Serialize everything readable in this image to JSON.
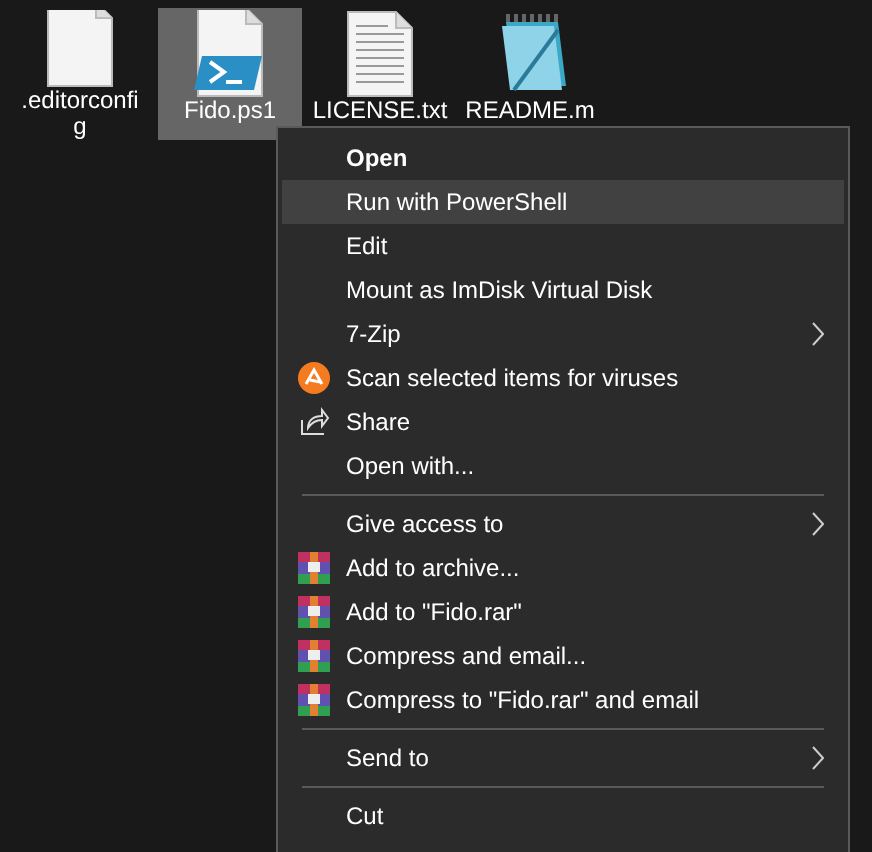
{
  "desktop_icons": [
    {
      "kind": "blank",
      "label_lines": [
        ".editorconfi",
        "g"
      ],
      "selected": false
    },
    {
      "kind": "script",
      "label_lines": [
        "Fido.ps1"
      ],
      "selected": true
    },
    {
      "kind": "text",
      "label_lines": [
        "LICENSE.txt"
      ],
      "selected": false
    },
    {
      "kind": "notepad",
      "label_lines": [
        "README.m"
      ],
      "selected": false
    }
  ],
  "context_menu": {
    "items": [
      {
        "kind": "item",
        "label": "Open",
        "bold": true,
        "selected": false,
        "submenu": false
      },
      {
        "kind": "item",
        "label": "Run with PowerShell",
        "bold": false,
        "selected": true,
        "submenu": false
      },
      {
        "kind": "item",
        "label": "Edit",
        "bold": false,
        "selected": false,
        "submenu": false
      },
      {
        "kind": "item",
        "label": "Mount as ImDisk Virtual Disk",
        "bold": false,
        "selected": false,
        "submenu": false
      },
      {
        "kind": "item",
        "label": "7-Zip",
        "bold": false,
        "selected": false,
        "submenu": true
      },
      {
        "kind": "antivirus_item",
        "label": "Scan selected items for viruses",
        "bold": false,
        "selected": false,
        "submenu": false
      },
      {
        "kind": "share_item",
        "label": "Share",
        "bold": false,
        "selected": false,
        "submenu": false
      },
      {
        "kind": "item",
        "label": "Open with...",
        "bold": false,
        "selected": false,
        "submenu": false
      },
      {
        "kind": "separator"
      },
      {
        "kind": "item",
        "label": "Give access to",
        "bold": false,
        "selected": false,
        "submenu": true
      },
      {
        "kind": "archive_item",
        "label": "Add to archive...",
        "bold": false,
        "selected": false,
        "submenu": false
      },
      {
        "kind": "archive_item",
        "label": "Add to \"Fido.rar\"",
        "bold": false,
        "selected": false,
        "submenu": false
      },
      {
        "kind": "archive_item",
        "label": "Compress and email...",
        "bold": false,
        "selected": false,
        "submenu": false
      },
      {
        "kind": "archive_item",
        "label": "Compress to \"Fido.rar\" and email",
        "bold": false,
        "selected": false,
        "submenu": false
      },
      {
        "kind": "separator"
      },
      {
        "kind": "item",
        "label": "Send to",
        "bold": false,
        "selected": false,
        "submenu": true
      },
      {
        "kind": "separator"
      },
      {
        "kind": "item",
        "label": "Cut",
        "bold": false,
        "selected": false,
        "submenu": false
      }
    ]
  }
}
